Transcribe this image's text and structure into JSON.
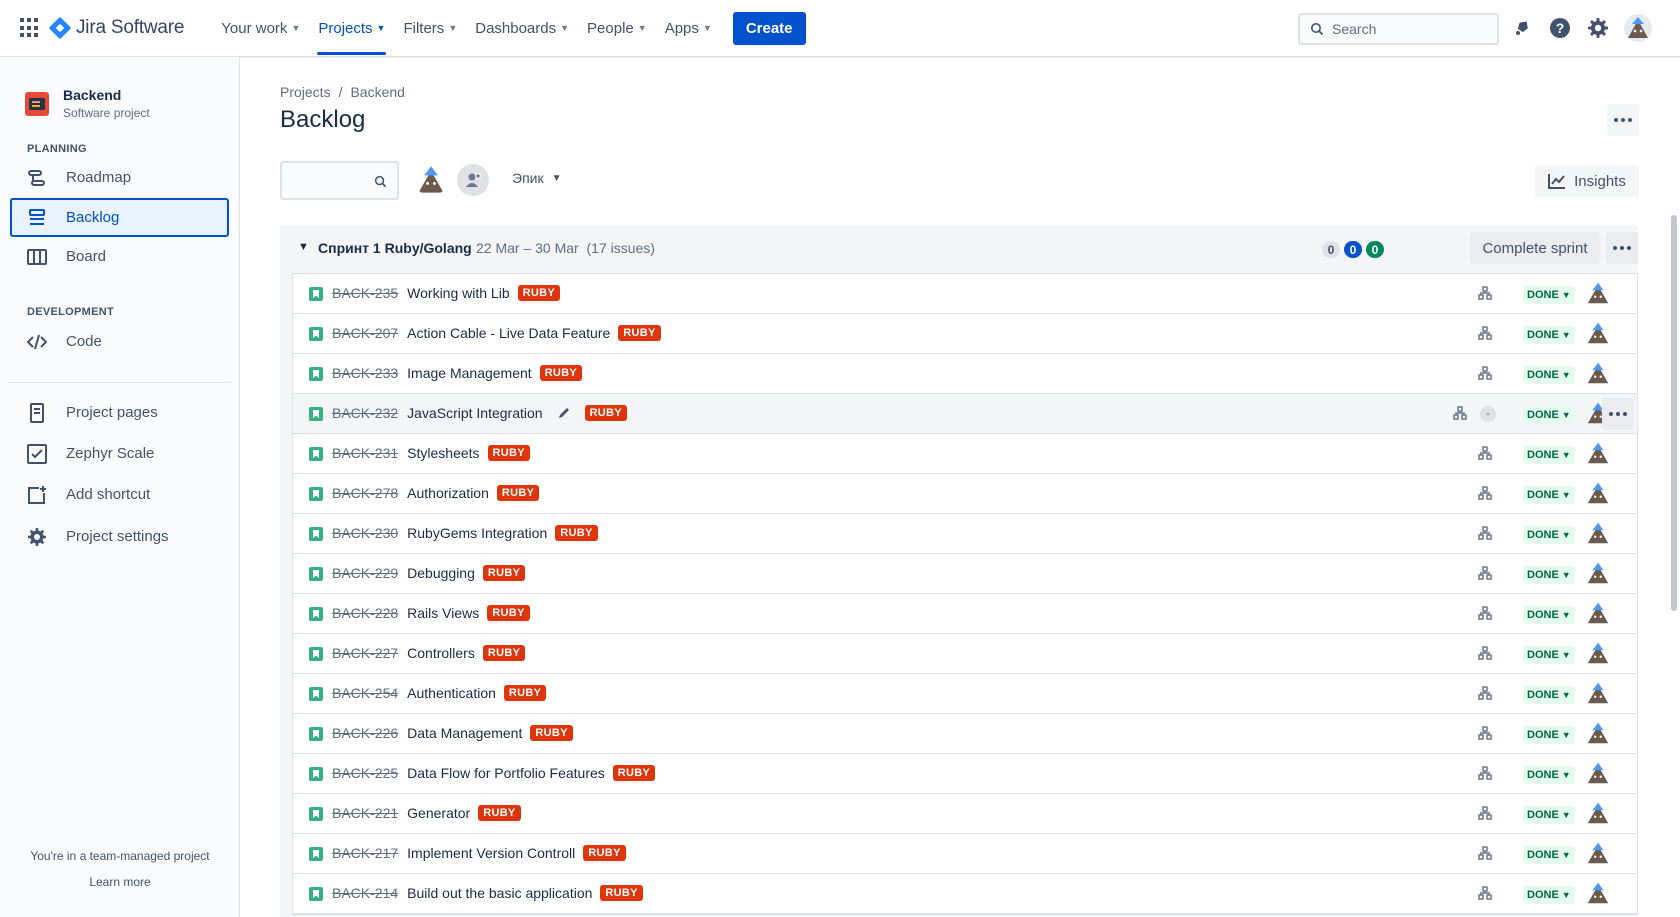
{
  "topnav": {
    "product": "Jira Software",
    "items": [
      {
        "label": "Your work"
      },
      {
        "label": "Projects"
      },
      {
        "label": "Filters"
      },
      {
        "label": "Dashboards"
      },
      {
        "label": "People"
      },
      {
        "label": "Apps"
      }
    ],
    "active_item": "Projects",
    "create_label": "Create",
    "search_placeholder": "Search"
  },
  "sidebar": {
    "project_name": "Backend",
    "project_type": "Software project",
    "planning_label": "PLANNING",
    "development_label": "DEVELOPMENT",
    "items": {
      "roadmap": "Roadmap",
      "backlog": "Backlog",
      "board": "Board",
      "code": "Code",
      "project_pages": "Project pages",
      "zephyr": "Zephyr Scale",
      "add_shortcut": "Add shortcut",
      "settings": "Project settings"
    },
    "footer_text": "You're in a team-managed project",
    "learn_more": "Learn more"
  },
  "breadcrumb": {
    "root": "Projects",
    "current": "Backend"
  },
  "page_title": "Backlog",
  "toolbar": {
    "epic_filter": "Эпик",
    "insights_label": "Insights"
  },
  "sprint": {
    "name": "Спринт 1 Ruby/Golang",
    "dates": "22 Mar – 30 Mar",
    "issue_count": "(17 issues)",
    "counts": {
      "todo": "0",
      "in_progress": "0",
      "done": "0"
    },
    "complete_label": "Complete sprint"
  },
  "issues": [
    {
      "key": "BACK-235",
      "summary": "Working with Lib",
      "label": "RUBY",
      "status": "DONE"
    },
    {
      "key": "BACK-207",
      "summary": "Action Cable - Live Data Feature",
      "label": "RUBY",
      "status": "DONE"
    },
    {
      "key": "BACK-233",
      "summary": "Image Management",
      "label": "RUBY",
      "status": "DONE"
    },
    {
      "key": "BACK-232",
      "summary": "JavaScript Integration",
      "label": "RUBY",
      "status": "DONE",
      "estimate": "-"
    },
    {
      "key": "BACK-231",
      "summary": "Stylesheets",
      "label": "RUBY",
      "status": "DONE"
    },
    {
      "key": "BACK-278",
      "summary": "Authorization",
      "label": "RUBY",
      "status": "DONE"
    },
    {
      "key": "BACK-230",
      "summary": "RubyGems Integration",
      "label": "RUBY",
      "status": "DONE"
    },
    {
      "key": "BACK-229",
      "summary": "Debugging",
      "label": "RUBY",
      "status": "DONE"
    },
    {
      "key": "BACK-228",
      "summary": "Rails Views",
      "label": "RUBY",
      "status": "DONE"
    },
    {
      "key": "BACK-227",
      "summary": "Controllers",
      "label": "RUBY",
      "status": "DONE"
    },
    {
      "key": "BACK-254",
      "summary": "Authentication",
      "label": "RUBY",
      "status": "DONE"
    },
    {
      "key": "BACK-226",
      "summary": "Data Management",
      "label": "RUBY",
      "status": "DONE"
    },
    {
      "key": "BACK-225",
      "summary": "Data Flow for Portfolio Features",
      "label": "RUBY",
      "status": "DONE"
    },
    {
      "key": "BACK-221",
      "summary": "Generator",
      "label": "RUBY",
      "status": "DONE"
    },
    {
      "key": "BACK-217",
      "summary": "Implement Version Controll",
      "label": "RUBY",
      "status": "DONE"
    },
    {
      "key": "BACK-214",
      "summary": "Build out the basic application",
      "label": "RUBY",
      "status": "DONE"
    }
  ],
  "colors": {
    "brand_blue": "#0052cc",
    "label_red": "#de350b",
    "done_green": "#006644",
    "story_green": "#36b37e"
  }
}
